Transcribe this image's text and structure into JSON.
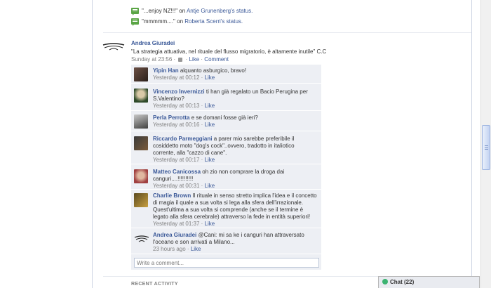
{
  "activity": [
    {
      "quote": "\"...enjoy NZ!!!\"",
      "on": " on ",
      "target": "Antje Grunenberg's status."
    },
    {
      "quote": "\"mmmmm....\"",
      "on": " on ",
      "target": "Roberta Scerri's status."
    }
  ],
  "post": {
    "author": "Andrea Giuradei",
    "text": "\"La strategia attuativa, nel rituale del flusso migratorio, è altamente inutile\" C.C",
    "time": "Sunday at 23:56",
    "sep": " · ",
    "like": "Like",
    "comment": "Comment"
  },
  "comments": [
    {
      "name": "Yipin Han",
      "text": " alquanto asburgico, bravo!",
      "time": "Yesterday at 00:12",
      "like": "Like"
    },
    {
      "name": "Vincenzo Invernizzi",
      "text": " ti han già regalato un Bacio Perugina per S.Valentino?",
      "time": "Yesterday at 00:13",
      "like": "Like"
    },
    {
      "name": "Perla Perrotta",
      "text": " e se domani fosse già ieri?",
      "time": "Yesterday at 00:16",
      "like": "Like"
    },
    {
      "name": "Riccardo Parmeggiani",
      "text": " a parer mio sarebbe preferibile il cosiddetto moto \"dog's cock\"..ovvero, tradotto in italiotico corrente, alla \"cazzo di cane\".",
      "time": "Yesterday at 00:17",
      "like": "Like"
    },
    {
      "name": "Matteo Canicossa",
      "text": " oh zio non comprare la droga dai canguri....!!!!!!!!!!",
      "time": "Yesterday at 00:31",
      "like": "Like"
    },
    {
      "name": "Charlie Brown",
      "text": " Il rituale in senso stretto implica l'idea e il concetto di magia il quale a sua volta si lega alla sfera dell'irrazionale. Quest'ultima a sua volta si comprende (anche se il termine è legato alla sfera cerebrale) attraverso la fede in entità superiori!",
      "time": "Yesterday at 01:37",
      "like": "Like"
    },
    {
      "name": "Andrea Giuradei",
      "text": " @Cani: mi sa ke i canguri han attraversato l'oceano e son arrivati a Milano...",
      "time": "23 hours ago",
      "like": "Like"
    }
  ],
  "write_placeholder": "Write a comment...",
  "recent_activity": "RECENT ACTIVITY",
  "chat": {
    "label": "Chat (22)"
  },
  "colors": {
    "link": "#3b5998",
    "comment_bg": "#edeff4",
    "activity_icon": "#5aa545"
  }
}
